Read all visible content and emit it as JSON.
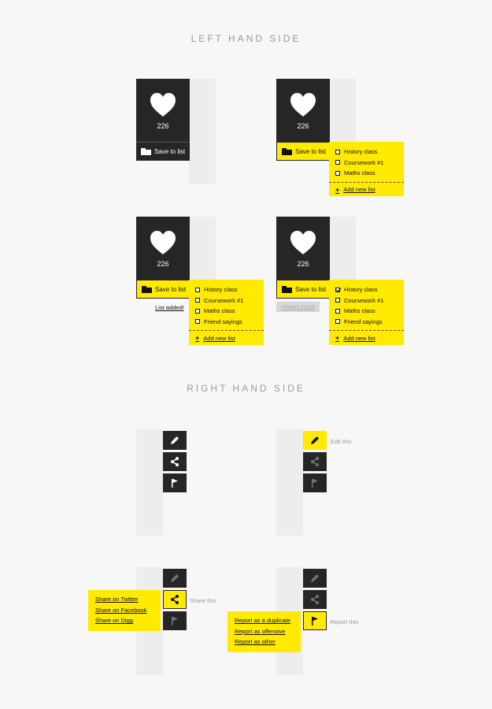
{
  "headings": {
    "left": "LEFT HAND SIDE",
    "right": "RIGHT HAND SIDE"
  },
  "like_count": "226",
  "save_label": "Save to list",
  "lists": {
    "short": [
      "History class",
      "Coursework #1",
      "Maths class"
    ],
    "long": [
      "History class",
      "Coursework #1",
      "Maths class",
      "Friend sayings"
    ]
  },
  "add_new_list": "Add new list",
  "list_added_note": "List added!",
  "history_note": "History class",
  "tool_labels": {
    "edit": "Edit this",
    "share": "Share this",
    "report": "Report this"
  },
  "share_options": [
    "Share on Twitter",
    "Share on Facebook",
    "Share on Digg"
  ],
  "report_options": [
    "Report as a duplicate",
    "Report as offensive",
    "Report as other"
  ],
  "icons": [
    "heart-icon",
    "folder-icon",
    "checkbox-icon",
    "plus-icon",
    "pencil-icon",
    "share-icon",
    "flag-icon"
  ],
  "colors": {
    "accent": "#ffea00",
    "dark": "#262626",
    "panel": "#ededed",
    "background": "#f7f7f7"
  }
}
